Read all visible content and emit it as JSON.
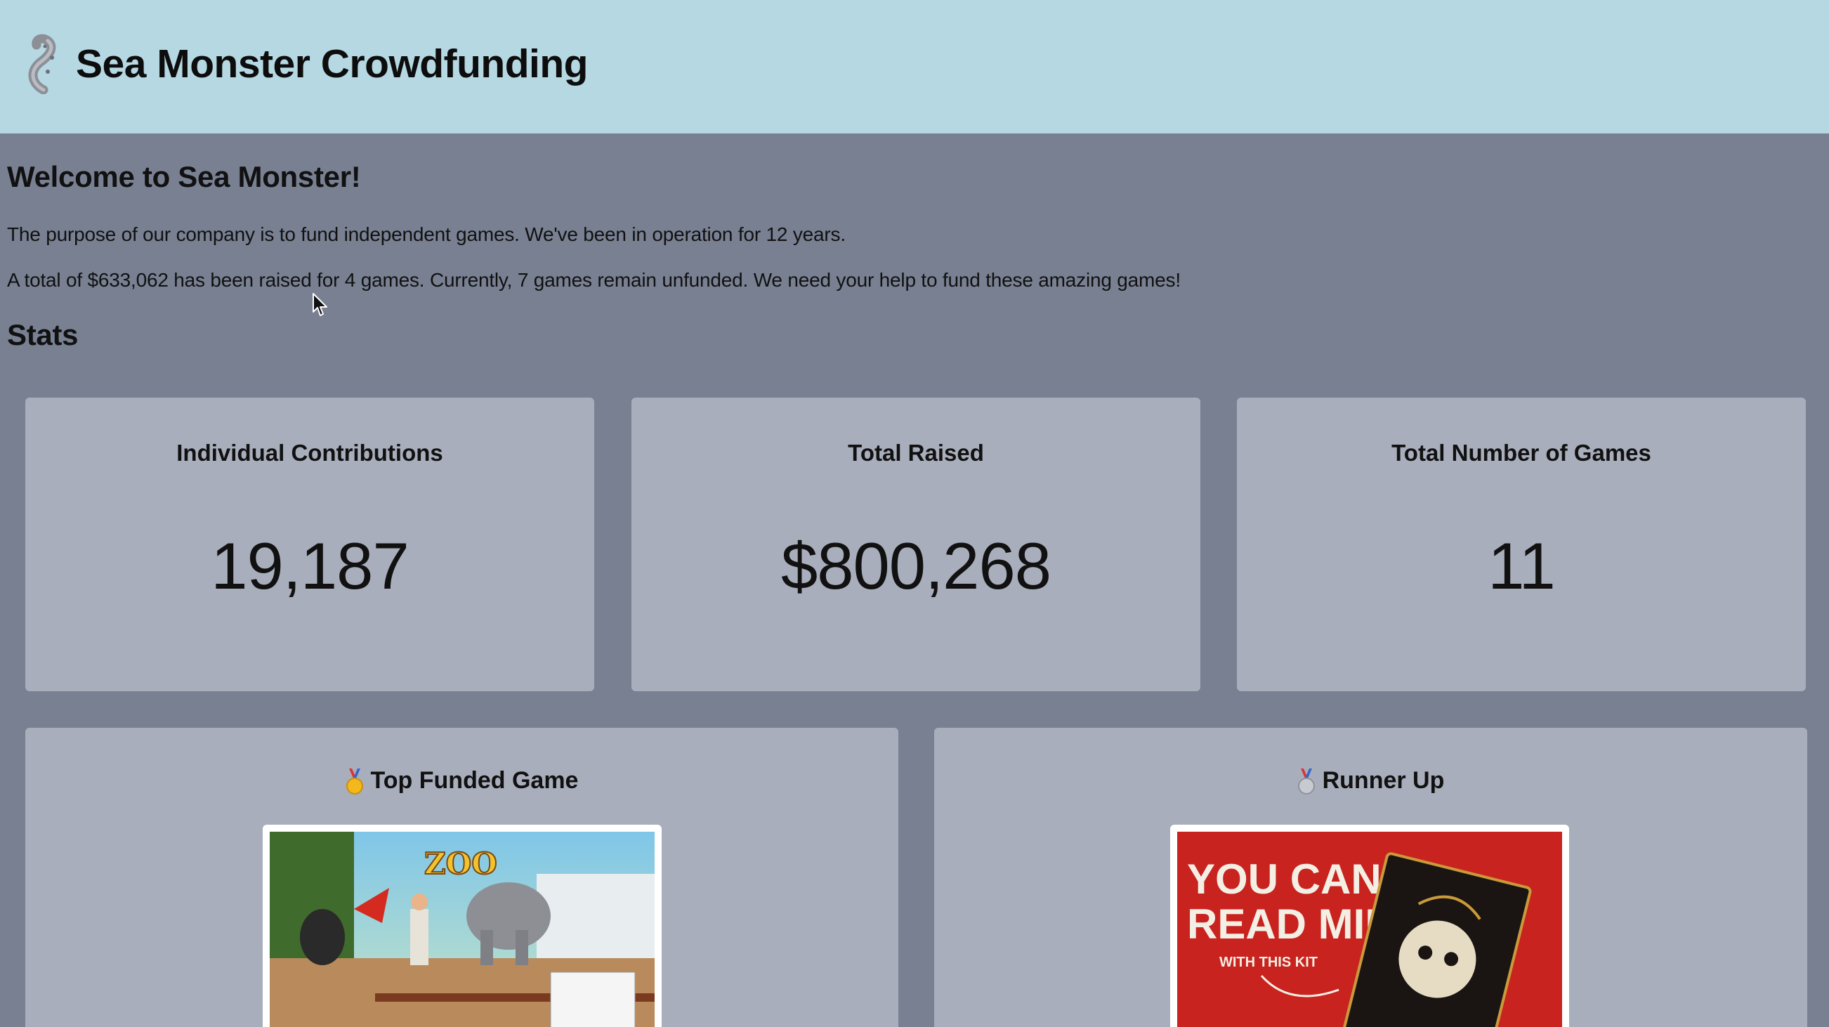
{
  "header": {
    "title": "Sea Monster Crowdfunding",
    "logo_icon": "sea-monster-tentacle-icon"
  },
  "intro": {
    "heading": "Welcome to Sea Monster!",
    "paragraph1": "The purpose of our company is to fund independent games. We've been in operation for 12 years.",
    "paragraph2": "A total of $633,062 has been raised for 4 games. Currently, 7 games remain unfunded. We need your help to fund these amazing games!"
  },
  "stats": {
    "heading": "Stats",
    "cards": [
      {
        "label": "Individual Contributions",
        "value": "19,187"
      },
      {
        "label": "Total Raised",
        "value": "$800,268"
      },
      {
        "label": "Total Number of Games",
        "value": "11"
      }
    ]
  },
  "featured": {
    "top": {
      "title": "Top Funded Game",
      "medal_icon": "gold-medal-icon",
      "image_text": "ZOO TYCOON"
    },
    "runner_up": {
      "title": "Runner Up",
      "medal_icon": "silver-medal-icon",
      "image_text_lines": [
        "YOU CAN",
        "READ MINDS",
        "WITH THIS KIT"
      ]
    }
  },
  "colors": {
    "header_bg": "#b5d8e3",
    "page_bg": "#788092",
    "card_bg": "#a9aebc",
    "runner_up_image_bg": "#c8231f"
  }
}
